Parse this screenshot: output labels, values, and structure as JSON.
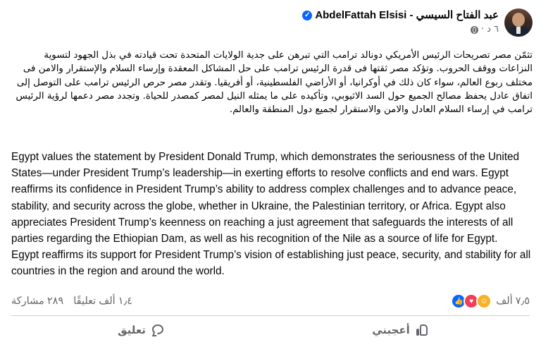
{
  "post": {
    "author_name": "AbdelFattah Elsisi - عبد الفتاح السيسي",
    "timestamp": "٦ د",
    "timestamp_separator": "·",
    "verified_mark": "✓",
    "arabic_paragraphs": [
      "تثمّن مصر تصريحات الرئيس الأمريكي دونالد ترامب التي تبرهن على جدية الولايات المتحدة تحت قيادته في بذل الجهود لتسوية النزاعات ووقف الحروب. وتؤكد مصر ثقتها فى قدرة الرئيس ترامب على حل المشاكل المعقدة وإرساء السلام والإستقرار والامن فى مختلف ربوع العالم، سواء كان ذلك في أوكرانيا، أو الأراضي الفلسطينية، أو أفريقيا. وتقدر مصر حرص الرئيس ترامب على التوصل إلى اتفاق عادل يحفظ مصالح الجميع حول السد الاثيوبي، وتأكيده على ما يمثله النيل لمصر كمصدر للحياة. وتجدد مصر دعمها لرؤية الرئيس ترامب في إرساء السلام العادل والامن والاستقرار لجميع دول المنطقة والعالم."
    ],
    "english_paragraphs": [
      "Egypt values the statement by President Donald Trump, which demonstrates the seriousness of the United States—under President Trump’s leadership—in exerting efforts to resolve conflicts and end wars. Egypt reaffirms its confidence in President Trump’s ability to address complex challenges and to advance peace, stability, and security across the globe, whether in Ukraine, the Palestinian territory, or Africa. Egypt also appreciates President Trump’s keenness on reaching a just agreement that safeguards the interests of all parties regarding the Ethiopian Dam, as well as his recognition of the Nile as a source of life for Egypt.",
      "Egypt reaffirms its support for President Trump’s vision of establishing just peace, security, and stability for all countries in the region and around the world."
    ]
  },
  "stats": {
    "reactions_count": "٧٫٥ ألف",
    "comments_count": "١٫٤ ألف تعليقًا",
    "shares_count": "٢٨٩ مشاركة",
    "reaction_icons": [
      "like",
      "love",
      "care"
    ]
  },
  "actions": {
    "like_label": "أعجبني",
    "comment_label": "تعليق"
  },
  "colors": {
    "accent": "#0866ff",
    "secondary_text": "#65676b",
    "love": "#f33e58",
    "care": "#f7b125"
  }
}
